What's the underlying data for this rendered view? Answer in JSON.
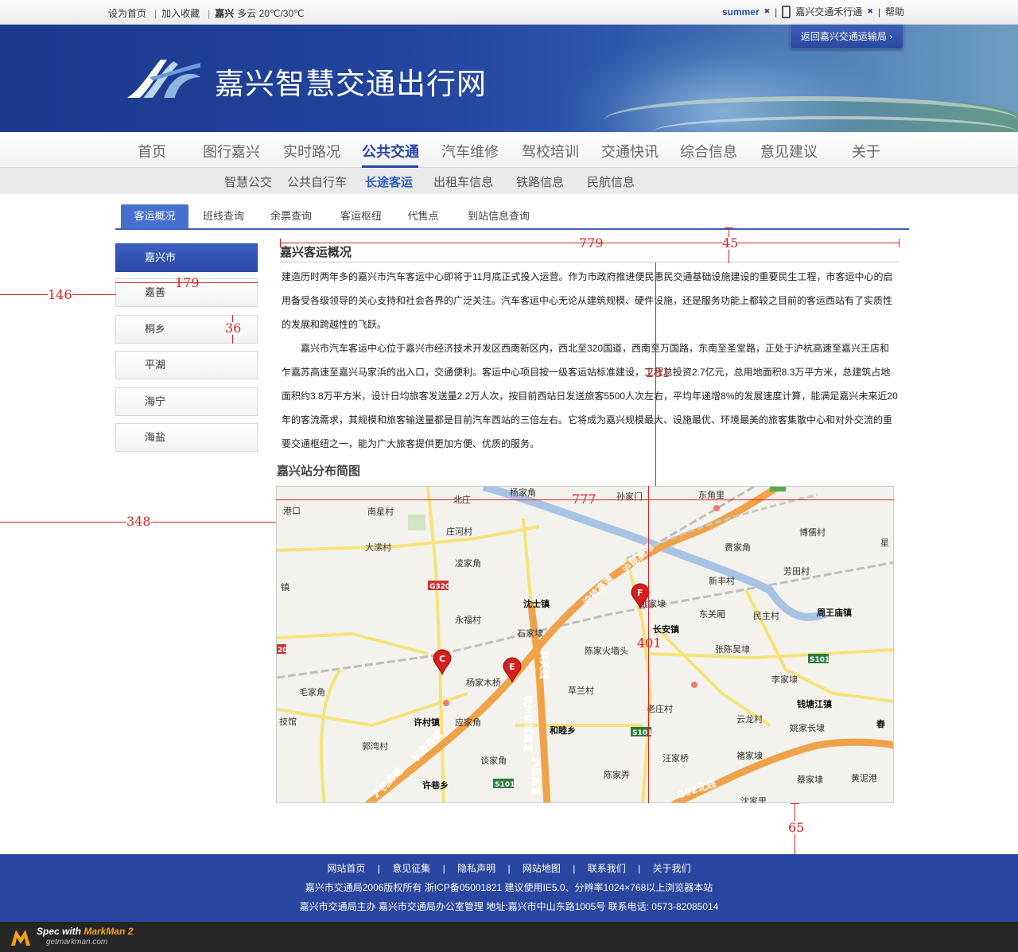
{
  "topbar": {
    "set_home": "设为首页",
    "favorite": "加入收藏",
    "city": "嘉兴",
    "weather": "多云 20℃/30℃",
    "user": "summer",
    "user_close": "✖",
    "app": "嘉兴交通禾行通",
    "app_close": "✖",
    "help": "帮助"
  },
  "banner": {
    "title": "嘉兴智慧交通出行网",
    "return_button": "返回嘉兴交通运输局 ›"
  },
  "main_nav": [
    "首页",
    "图行嘉兴",
    "实时路况",
    "公共交通",
    "汽车维修",
    "驾校培训",
    "交通快讯",
    "综合信息",
    "意见建议",
    "关于"
  ],
  "sub_nav": [
    "智慧公交",
    "公共自行车",
    "长途客运",
    "出租车信息",
    "铁路信息",
    "民航信息"
  ],
  "tabs": [
    "客运概况",
    "班线查询",
    "余票查询",
    "客运枢纽",
    "代售点",
    "到站信息查询"
  ],
  "side_menu": [
    "嘉兴市",
    "嘉善",
    "桐乡",
    "平湖",
    "海宁",
    "海盐"
  ],
  "content": {
    "title": "嘉兴客运概况",
    "para1": "建造历时两年多的嘉兴市汽车客运中心即将于11月底正式投入运营。作为市政府推进便民惠民交通基础设施建设的重要民生工程，市客运中心的启用备受各级领导的关心支持和社会各界的广泛关注。汽车客运中心无论从建筑规模、硬件设施，还是服务功能上都较之目前的客运西站有了实质性的发展和跨越性的飞跃。",
    "para2": "嘉兴市汽车客运中心位于嘉兴市经济技术开发区西南新区内，西北至320国道，西南至万国路，东南至圣堂路，正处于沪杭高速至嘉兴王店和乍嘉苏高速至嘉兴马家浜的出入口，交通便利。客运中心项目按一级客运站标准建设，工程总投资2.7亿元，总用地面积8.3万平方米，总建筑占地面积约3.8万平方米，设计日均旅客发送量2.2万人次，按目前西站日发送旅客5500人次左右，平均年递增8%的发展速度计算，能满足嘉兴未来近20年的客流需求，其规模和旅客输送量都是目前汽车西站的三倍左右。它将成为嘉兴规模最大、设施最优、环境最美的旅客集散中心和对外交流的重要交通枢纽之一，能为广大旅客提供更加方便、优质的服务。",
    "map_title": "嘉兴站分布简图"
  },
  "map": {
    "places": [
      "杨家角",
      "北庄",
      "孙家门",
      "东角里",
      "港口",
      "南星村",
      "庄河村",
      "博儒村",
      "星",
      "大潆村",
      "费家角",
      "凌家角",
      "芳田村",
      "镇",
      "新丰村",
      "沈士镇",
      "戴家埭",
      "周王庙镇",
      "永福村",
      "东关厢",
      "民主村",
      "石家埭",
      "长安镇",
      "陈家火墙头",
      "张陈吴埭",
      "杨家木桥",
      "李家埭",
      "毛家角",
      "草兰村",
      "钱塘江镇",
      "老庄村",
      "许村镇",
      "应家角",
      "和睦乡",
      "云龙村",
      "姚家长埭",
      "技馆",
      "郭湾村",
      "汪家桥",
      "褚家埭",
      "春",
      "谈家角",
      "陈家弄",
      "蔡家埭",
      "黄泥港",
      "许巷乡",
      "沈家里"
    ],
    "road_labels": [
      "G320",
      "S101",
      "S101",
      "S101",
      "20"
    ],
    "highway_labels": [
      "沪杭高速",
      "沪昆高速",
      "杭州绕城高速",
      "沪昆高速",
      "科天线",
      "沪杭高速",
      "杭甬高速",
      "G92北线"
    ],
    "markers": [
      "C",
      "E",
      "F"
    ],
    "colors": {
      "highway": "#f0a24a",
      "road": "#f6e27a",
      "river": "#a8c4e4",
      "marker": "#d81e1e"
    }
  },
  "measurements": [
    "779",
    "45",
    "146",
    "179",
    "36",
    "281",
    "348",
    "777",
    "401",
    "65"
  ],
  "footer": {
    "links": [
      "网站首页",
      "|",
      "意见征集",
      "|",
      "隐私声明",
      "|",
      "网站地图",
      "|",
      "联系我们",
      "|",
      "关于我们"
    ],
    "copyright": "嘉兴市交通局2006版权所有 浙ICP备05001821 建议使用IE5.0、分辨率1024×768以上浏览器本站",
    "contact": "嘉兴市交通局主办 嘉兴市交通局办公室管理  地址:嘉兴市中山东路1005号 联系电话: 0573-82085014"
  },
  "markman": {
    "spec_prefix": "Spec with ",
    "brand": "MarkMan 2",
    "url": "getmarkman.com"
  }
}
